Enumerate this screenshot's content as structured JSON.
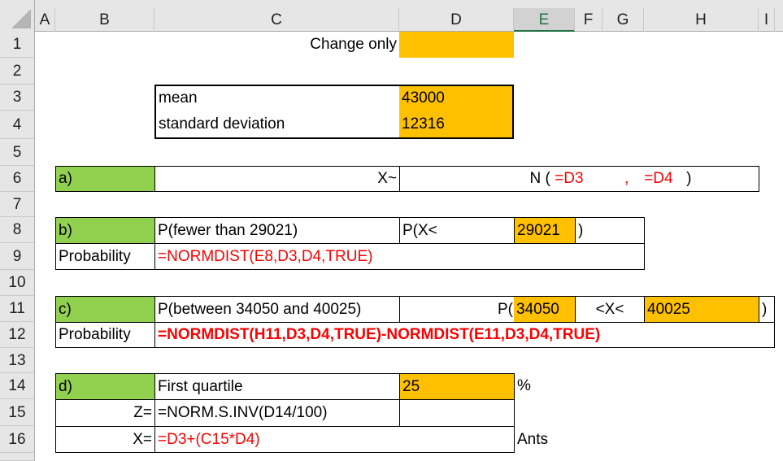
{
  "columns": [
    "A",
    "B",
    "C",
    "D",
    "E",
    "F",
    "G",
    "H",
    "I"
  ],
  "selected_column": "E",
  "rows": [
    "1",
    "2",
    "3",
    "4",
    "5",
    "6",
    "7",
    "8",
    "9",
    "10",
    "11",
    "12",
    "13",
    "14",
    "15",
    "16"
  ],
  "colors": {
    "input": "#ffc000",
    "label": "#92d050",
    "formula": "#ff0000"
  },
  "header_note": {
    "label": "Change only"
  },
  "params": {
    "mean_label": "mean",
    "mean_value": "43000",
    "sd_label": "standard deviation",
    "sd_value": "12316"
  },
  "part_a": {
    "label": "a)",
    "x_tilde": "X~",
    "n_open": "N (",
    "mean_ref": "=D3",
    "comma": ",",
    "sd_ref": "=D4",
    "close": ")"
  },
  "part_b": {
    "label": "b)",
    "desc": "P(fewer than 29021)",
    "px": "P(X<",
    "value": "29021",
    "close": ")",
    "prob_label": "Probability",
    "formula": "=NORMDIST(E8,D3,D4,TRUE)"
  },
  "part_c": {
    "label": "c)",
    "desc": "P(between 34050 and 40025)",
    "p_open": "P(",
    "lower": "34050",
    "mid": "<X<",
    "upper": "40025",
    "close": ")",
    "prob_label": "Probability",
    "formula": "=NORMDIST(H11,D3,D4,TRUE)-NORMDIST(E11,D3,D4,TRUE)"
  },
  "part_d": {
    "label": "d)",
    "desc": "First quartile",
    "value": "25",
    "pct": "%",
    "z_label": "Z=",
    "z_formula": "=NORM.S.INV(D14/100)",
    "x_label": "X=",
    "x_formula": "=D3+(C15*D4)",
    "unit": "Ants"
  }
}
